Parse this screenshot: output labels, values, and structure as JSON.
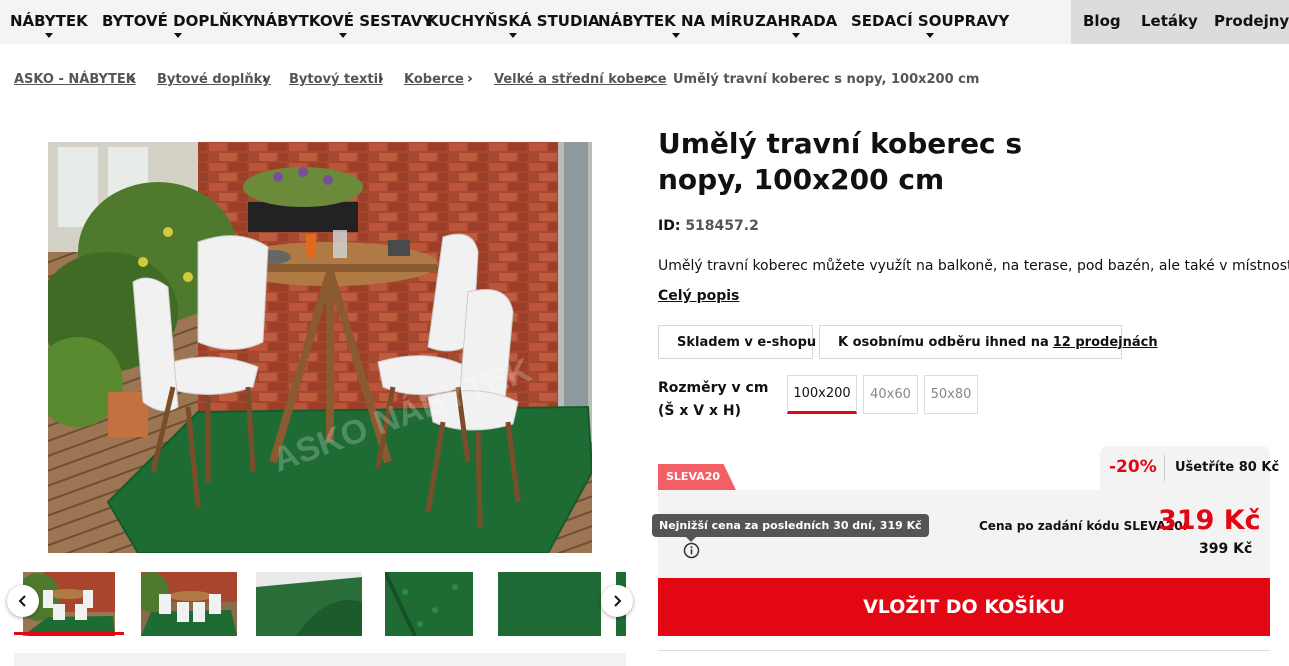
{
  "nav": {
    "items": [
      {
        "label": "NÁBYTEK"
      },
      {
        "label": "BYTOVÉ DOPLŇKY"
      },
      {
        "label": "NÁBYTKOVÉ SESTAVY"
      },
      {
        "label": "KUCHYŇSKÁ STUDIA"
      },
      {
        "label": "NÁBYTEK NA MÍRU"
      },
      {
        "label": "ZAHRADA"
      },
      {
        "label": "SEDACÍ SOUPRAVY"
      }
    ],
    "right": [
      {
        "label": "Blog"
      },
      {
        "label": "Letáky"
      },
      {
        "label": "Prodejny"
      }
    ]
  },
  "breadcrumb": {
    "items": [
      {
        "label": "ASKO - NÁBYTEK"
      },
      {
        "label": "Bytové doplňky"
      },
      {
        "label": "Bytový textil"
      },
      {
        "label": "Koberce"
      },
      {
        "label": "Velké a střední koberce"
      },
      {
        "label": "Umělý travní koberec s nopy, 100x200 cm"
      }
    ],
    "separator": "›"
  },
  "product": {
    "title": "Umělý travní koberec s nopy, 100x200 cm",
    "id_label": "ID:",
    "id_value": "518457.2",
    "description": "Umělý travní koberec můžete využít na balkoně, na terase, pod bazén, ale také v místnosti.",
    "full_description_link": "Celý popis",
    "stock": {
      "eshop": "Skladem v e-shopu",
      "pickup": "K osobnímu odběru ihned na",
      "pickup_link": "12 prodejnách"
    },
    "dimensions": {
      "label_line1": "Rozměry v cm",
      "label_line2": "(Š x V x H)",
      "options": [
        "100x200",
        "40x60",
        "50x80"
      ],
      "selected": "100x200"
    },
    "price": {
      "promo_tag": "SLEVA20",
      "discount": "-20%",
      "saving": "Ušetříte 80 Kč",
      "tooltip": "Nejnižší cena za posledních 30 dní, 319 Kč",
      "code_label": "Cena po zadání kódu SLEVA20:",
      "new_price": "319 Kč",
      "old_price": "399 Kč"
    },
    "cart_button": "VLOŽIT DO KOŠÍKU"
  },
  "gallery": {
    "watermark": "ASKO NÁBYTEK",
    "thumbnail_count": 6,
    "active_index": 0
  },
  "colors": {
    "accent": "#e30613",
    "promo_tag": "#f26065",
    "stock_check": "#2e9e3e",
    "grass": "#1f6b34"
  }
}
